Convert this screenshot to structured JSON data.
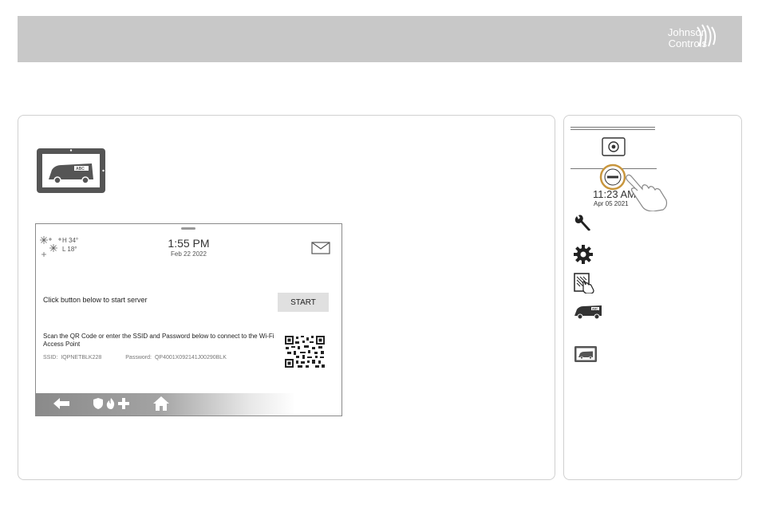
{
  "brand": {
    "line1": "Johnson",
    "line2": "Controls"
  },
  "screen": {
    "weather": {
      "high": "H 34°",
      "low": "L 18°"
    },
    "time": "1:55 PM",
    "date": "Feb 22 2022",
    "instruction": "Click button below to start server",
    "start_label": "START",
    "scan_text": "Scan the QR Code or enter the SSID and Password below to connect to the Wi-Fi Access Point",
    "ssid_label": "SSID:",
    "ssid_value": "IQPNETBLK228",
    "password_label": "Password:",
    "password_value": "QP4001X092141J00290BLK"
  },
  "side": {
    "time": "11:23 AM",
    "date": "Apr 05 2021"
  },
  "icons": [
    "johnson-controls-logo",
    "tablet-van-icon",
    "snowflake-icon",
    "envelope-icon",
    "qr-code",
    "back-arrow-icon",
    "shield-icon",
    "fire-icon",
    "plus-icon",
    "home-icon",
    "power-icon",
    "minus-icon",
    "hand-pointer-icon",
    "wrench-icon",
    "gear-icon",
    "touch-panel-icon",
    "van-icon"
  ],
  "colors": {
    "header": "#c8c8c8",
    "accent_ring": "#c8963e",
    "nav_dark": "#8a8a8a"
  }
}
